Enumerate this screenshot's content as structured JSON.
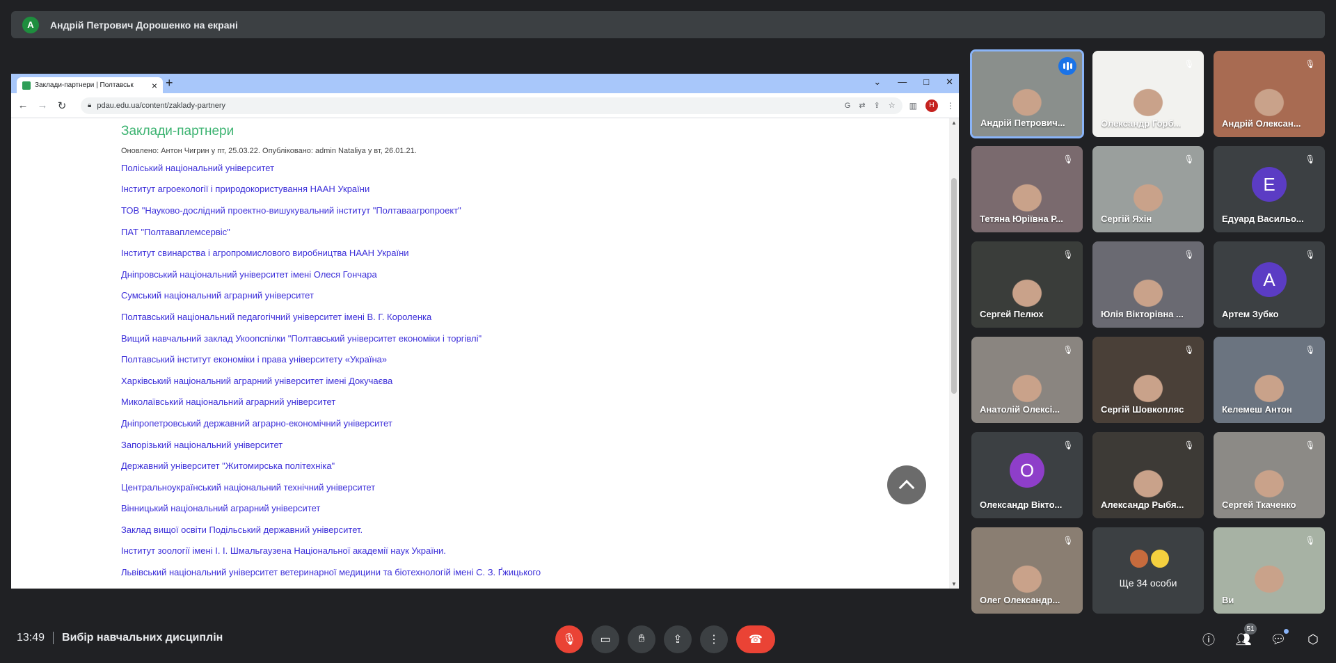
{
  "banner": {
    "avatar_letter": "A",
    "text": "Андрій Петрович Дорошенко на екрані"
  },
  "browser": {
    "tab_title": "Заклади-партнери | Полтавськ",
    "url": "pdau.edu.ua/content/zaklady-partnery",
    "profile_letter": "Н"
  },
  "page": {
    "heading": "Заклади-партнери",
    "meta": "Оновлено: Антон Чигрин у пт, 25.03.22. Опубліковано: admin Nataliya у вт, 26.01.21.",
    "links": [
      "Поліський національний університет",
      "Інститут агроекології і природокористування НААН України",
      "ТОВ \"Науково-дослідний проектно-вишукувальний інститут \"Полтаваагропроект\"",
      "ПАТ \"Полтаваплемсервіс\"",
      "Інститут свинарства і агропромислового виробництва НААН України",
      "Дніпровський національний університет імені Олеся Гончара",
      "Сумський національний аграрний університет",
      "Полтавський національний педагогічний університет імені В. Г. Короленка",
      "Вищий навчальний заклад Укоопспілки \"Полтавський університет економіки і торгівлі\"",
      "Полтавський інститут економіки і права університету «Україна»",
      "Харківський національний аграрний університет імені Докучаєва",
      "Миколаївський національний аграрний університет",
      "Дніпропетровський державний аграрно-економічний університет",
      "Запорізький національний університет",
      "Державний університет \"Житомирська політехніка\"",
      "Центральноукраїнський національний технічний університет",
      "Вінницький національний аграрний університет",
      "Заклад вищої освіти Подільський державний університет.",
      "Інститут зоології імені І. І. Шмальгаузена Національної академії наук України.",
      "Львівський національний університет ветеринарної медицини та біотехнологій імені С. З. Ґжицького"
    ]
  },
  "participants": [
    {
      "name": "Андрій Петрович...",
      "color": "#8a8f8c",
      "speaking": true
    },
    {
      "name": "Олександр Горб...",
      "color": "#f2f2ef"
    },
    {
      "name": "Андрій Олексан...",
      "color": "#a86b52"
    },
    {
      "name": "Тетяна Юріївна Р...",
      "color": "#7a6a6e"
    },
    {
      "name": "Сергій Яхін",
      "color": "#9a9f9d"
    },
    {
      "name": "Едуард Васильо...",
      "letter": "E",
      "letter_color": "#5b3cc4"
    },
    {
      "name": "Сергей Пелюх",
      "color": "#3a3d3a"
    },
    {
      "name": "Юлія Вікторівна ...",
      "color": "#6a6a72"
    },
    {
      "name": "Артем Зубко",
      "letter": "A",
      "letter_color": "#5b3cc4"
    },
    {
      "name": "Анатолій Олексі...",
      "color": "#8a8580"
    },
    {
      "name": "Сергій Шовкопляс",
      "color": "#4a4038"
    },
    {
      "name": "Келемеш Антон",
      "color": "#6b7480"
    },
    {
      "name": "Олександр Вікто...",
      "letter": "O",
      "letter_color": "#8e3ec9"
    },
    {
      "name": "Александр Рыбя...",
      "color": "#3d3a36"
    },
    {
      "name": "Сергей Ткаченко",
      "color": "#8c8a86"
    },
    {
      "name": "Олег Олександр...",
      "color": "#8a7e72"
    },
    {
      "name": "Ще 34 особи",
      "more": true
    },
    {
      "name": "Ви",
      "color": "#a7b2a4"
    }
  ],
  "bottom": {
    "time": "13:49",
    "meeting_name": "Вибір навчальних дисциплін",
    "people_count": "51"
  }
}
